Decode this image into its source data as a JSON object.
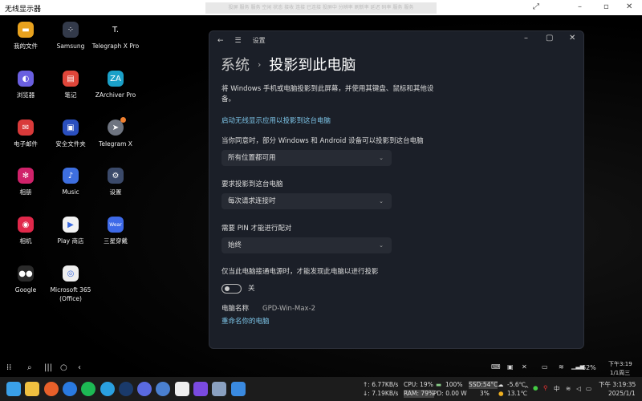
{
  "titlebar": {
    "title": "无线显示器",
    "banner": "投屏 服务 服务 空闲 状态 接收 连接 已连接 投屏中 分辨率 刷新率 延迟 码率 服务 服务"
  },
  "apps": [
    {
      "label": "我的文件",
      "color": "#e8a21e",
      "glyph": "▬"
    },
    {
      "label": "Samsung",
      "color": "#333a4a",
      "glyph": "⁘"
    },
    {
      "label": "Telegraph X Pro",
      "color": "#000000",
      "glyph": "T."
    },
    {
      "label": "浏览器",
      "color": "#6a5fe0",
      "glyph": "◐"
    },
    {
      "label": "笔记",
      "color": "#e0463a",
      "glyph": "▤"
    },
    {
      "label": "ZArchiver Pro",
      "color": "#1aa0c8",
      "glyph": "ZA"
    },
    {
      "label": "电子邮件",
      "color": "#d93a3a",
      "glyph": "✉"
    },
    {
      "label": "安全文件夹",
      "color": "#2a4fbf",
      "glyph": "▣"
    },
    {
      "label": "Telegram X",
      "color": "#6e7480",
      "glyph": "➤"
    },
    {
      "label": "相册",
      "color": "#d0226a",
      "glyph": "✻"
    },
    {
      "label": "Music",
      "color": "#3e6fe0",
      "glyph": "♪"
    },
    {
      "label": "设置",
      "color": "#3b4a6a",
      "glyph": "⚙"
    },
    {
      "label": "相机",
      "color": "#e0284a",
      "glyph": "◉"
    },
    {
      "label": "Play 商店",
      "color": "#f2f2f2",
      "glyph": "▶"
    },
    {
      "label": "三星穿戴",
      "color": "#3e6ae8",
      "glyph": "Wear"
    },
    {
      "label": "Google",
      "color": "#2a2a2a",
      "glyph": "●●"
    },
    {
      "label": "Microsoft 365 (Office)",
      "color": "#eeeeee",
      "glyph": "◎"
    }
  ],
  "settings": {
    "app_name": "设置",
    "breadcrumb_parent": "系统",
    "breadcrumb_current": "投影到此电脑",
    "description": "将 Windows 手机或电脑投影到此屏幕，并使用其键盘、鼠标和其他设备。",
    "launch_link": "启动无线显示应用以投影到这台电脑",
    "availability_label": "当你同意时，部分 Windows 和 Android 设备可以投影到这台电脑",
    "availability_value": "所有位置都可用",
    "ask_label": "要求投影到这台电脑",
    "ask_value": "每次请求连接时",
    "pin_label": "需要 PIN 才能进行配对",
    "pin_value": "始终",
    "power_label": "仅当此电脑接通电源时，才能发现此电脑以进行投影",
    "power_toggle_state": "关",
    "pc_name_label": "电脑名称",
    "pc_name_value": "GPD-Win-Max-2",
    "rename_link": "重命名你的电脑"
  },
  "android_status": {
    "battery": "62%",
    "time": "下午3:19",
    "date": "1/1周三"
  },
  "taskbar": {
    "net_up": "↑: 6.77KB/s",
    "net_down": "↓: 7.19KB/s",
    "cpu": "CPU: 19%",
    "battery": "100%",
    "ram": "RAM: 79%",
    "pd": "PD: 0.00 W",
    "ssd": "SSD:54°C",
    "ssd_use": "3%",
    "weather1": "-5.6℃",
    "weather2": "13.1℃",
    "ime": "中",
    "time": "下午 3:19:35",
    "date": "2025/1/1",
    "pinned": [
      {
        "name": "start",
        "color": "#3aa0e8"
      },
      {
        "name": "file-explorer",
        "color": "#f0c040"
      },
      {
        "name": "firefox",
        "color": "#e8602a"
      },
      {
        "name": "app-blue",
        "color": "#2a7ae0"
      },
      {
        "name": "spotify",
        "color": "#1db954"
      },
      {
        "name": "telegram",
        "color": "#2aa0e0"
      },
      {
        "name": "steam",
        "color": "#1a3a6a"
      },
      {
        "name": "app-ring",
        "color": "#5a6ae0"
      },
      {
        "name": "qbittorrent",
        "color": "#4a80d0"
      },
      {
        "name": "installer",
        "color": "#eeeeee"
      },
      {
        "name": "app-w",
        "color": "#7a4ae0"
      },
      {
        "name": "settings",
        "color": "#8aa0c0"
      },
      {
        "name": "wireless-display",
        "color": "#3a8ae0"
      }
    ]
  }
}
